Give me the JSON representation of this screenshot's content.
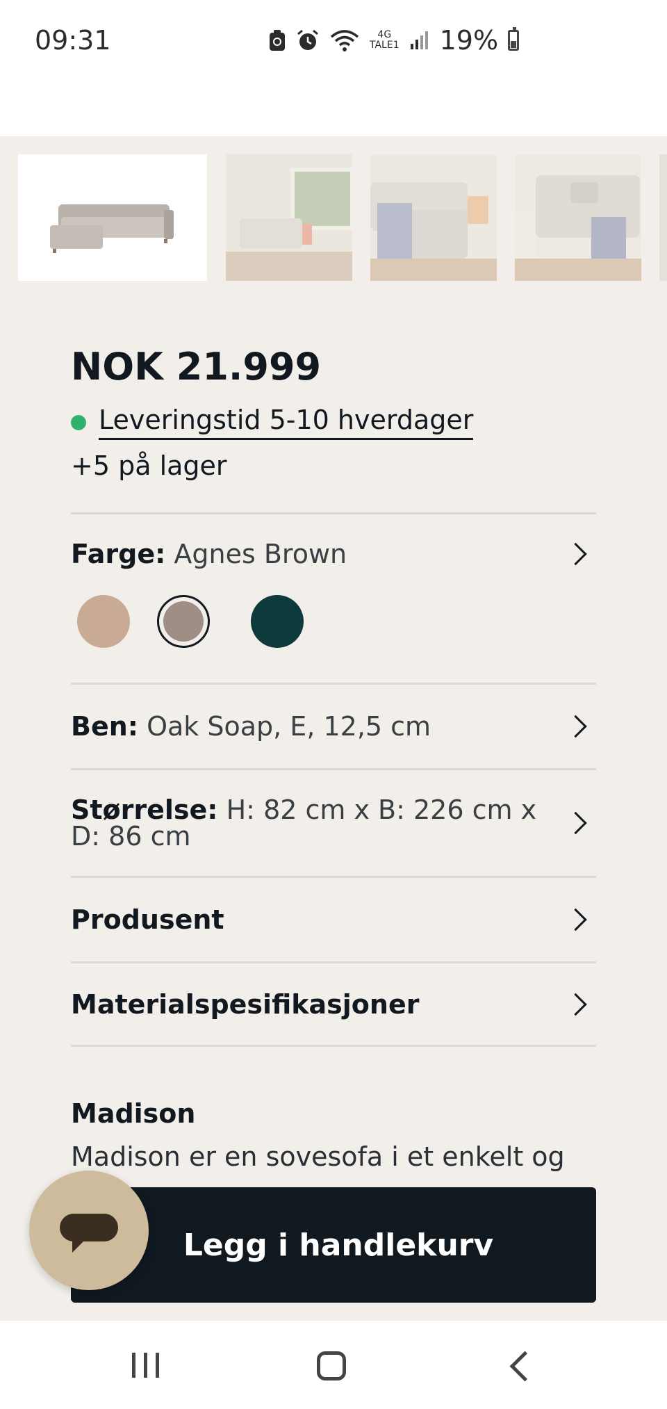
{
  "status_bar": {
    "time": "09:31",
    "network_top": "4G",
    "network_bottom": "TALE1",
    "battery": "19%",
    "icons": [
      "screenshot-icon",
      "alarm-icon",
      "wifi-icon",
      "signal-icon",
      "battery-icon"
    ]
  },
  "gallery": {
    "thumbnails": [
      "sofa-product-image",
      "living-room-photo",
      "sofa-closeup-photo",
      "sofa-cushions-photo",
      "partial-photo"
    ],
    "selected_index": 0
  },
  "product": {
    "price": "NOK 21.999",
    "delivery": "Leveringstid 5-10 hverdager",
    "delivery_status_color": "#2fb26e",
    "stock": "+5 på lager"
  },
  "options": {
    "color": {
      "key": "Farge:",
      "value": "Agnes Brown",
      "swatches": [
        {
          "name": "beige",
          "color": "#c9ab95"
        },
        {
          "name": "agnes-brown",
          "color": "#9e8e85",
          "selected": true
        },
        {
          "name": "dark-teal",
          "color": "#0f3a3b"
        }
      ]
    },
    "legs": {
      "key": "Ben:",
      "value": "Oak Soap, E, 12,5 cm"
    },
    "size": {
      "key": "Størrelse:",
      "value": "H: 82 cm x B: 226 cm x D: 86 cm"
    },
    "manufacturer": {
      "key": "Produsent"
    },
    "materials": {
      "key": "Materialspesifikasjoner"
    }
  },
  "description": {
    "title": "Madison",
    "text": "Madison er en sovesofa i et enkelt og"
  },
  "cart": {
    "label": "Legg i handlekurv"
  },
  "colors": {
    "accent_dark": "#101820",
    "background": "#f2efea",
    "chat_fab": "#cdbb9c"
  },
  "nav": {
    "icons": [
      "recents-icon",
      "home-icon",
      "back-icon"
    ]
  }
}
